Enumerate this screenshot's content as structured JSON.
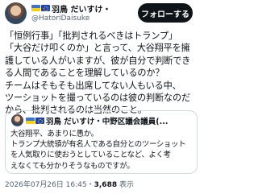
{
  "author": {
    "name": "羽鳥 だいすけ・",
    "handle": "@HatoriDaisuke"
  },
  "follow_button": "フォローする",
  "tweet_lines": [
    "「恒例行事」「批判されるべきはトランプ」",
    "「大谷だけ叩くのか」と言って、大谷翔平を擁",
    "護している人がいますが、彼が自分で判断でき",
    "る人間であることを理解しているのか？",
    "チームはそもそも出席してない人もいる中、",
    "ツーショットを撮っているのは彼の判断なのだ",
    "から、批判されるのは当然のこと。"
  ],
  "quoted": {
    "name": "羽鳥 だいすけ・中野区議会議員(...",
    "text_lines": [
      "大谷翔平、あまりに愚か。",
      "トランプ大統領が有名人である自分とのツーショット",
      "を人気取りに使おうとしていることなど、よく考",
      "えなくても分かりそうなものですが。"
    ]
  },
  "timestamp": "2026年07月26日 16:45",
  "separator": "・",
  "views_count": "3,688",
  "views_label": " 表示"
}
